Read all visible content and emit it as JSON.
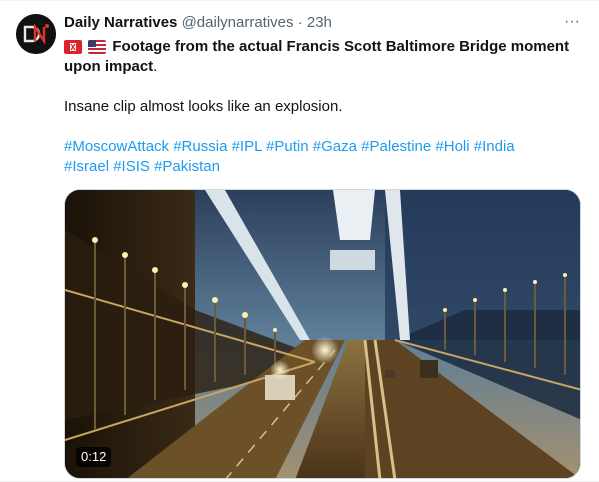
{
  "tweet": {
    "author_name": "Daily Narratives",
    "handle": "@dailynarratives",
    "separator": "·",
    "time": "23h",
    "more_label": "···",
    "avatar_icon": "daily-narratives-logo",
    "flags": [
      "flag-icon-red",
      "us-flag-icon"
    ],
    "line1": "Footage from the actual Francis Scott Baltimore Bridge moment upon impact",
    "line1_suffix": ".",
    "line2": "Insane clip almost looks like an explosion.",
    "hashtags": [
      "#MoscowAttack",
      "#Russia",
      "#IPL",
      "#Putin",
      "#Gaza",
      "#Palestine",
      "#Holi",
      "#India",
      "#Israel",
      "#ISIS",
      "#Pakistan"
    ]
  },
  "media": {
    "duration": "0:12",
    "description_icon": "video-thumbnail"
  },
  "colors": {
    "link": "#1d9bf0",
    "secondary": "#536471",
    "primary": "#0f1419"
  }
}
